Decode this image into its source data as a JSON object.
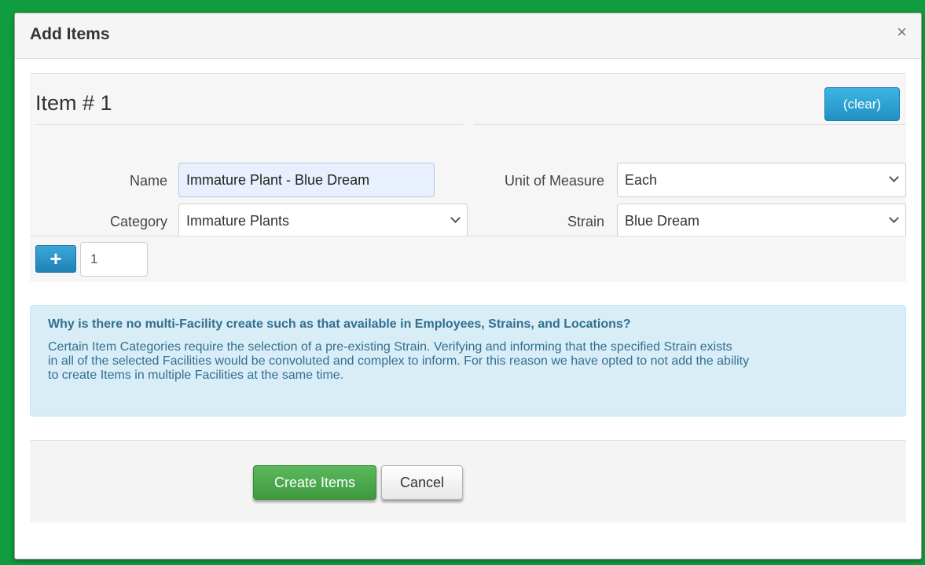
{
  "modal": {
    "title": "Add Items",
    "close_icon": "×"
  },
  "item": {
    "heading": "Item # 1",
    "clear_label": "(clear)",
    "fields": {
      "name_label": "Name",
      "name_value": "Immature Plant - Blue Dream",
      "category_label": "Category",
      "category_value": "Immature Plants",
      "uom_label": "Unit of Measure",
      "uom_value": "Each",
      "strain_label": "Strain",
      "strain_value": "Blue Dream"
    },
    "add_icon": "+",
    "add_count": "1"
  },
  "info": {
    "title": "Why is there no multi-Facility create such as that available in Employees, Strains, and Locations?",
    "body_line1": "Certain Item Categories require the selection of a pre-existing Strain. Verifying and informing that the specified Strain exists",
    "body_line2": "in all of the selected Facilities would be convoluted and complex to inform. For this reason we have opted to not add the ability",
    "body_line3": "to create Items in multiple Facilities at the same time."
  },
  "footer": {
    "create_label": "Create Items",
    "cancel_label": "Cancel"
  },
  "colors": {
    "frame_border": "#0f9d3f",
    "info_bg": "#d9edf7",
    "info_text": "#31708f",
    "primary_btn": "#2190c2",
    "success_btn": "#5cb85c"
  }
}
